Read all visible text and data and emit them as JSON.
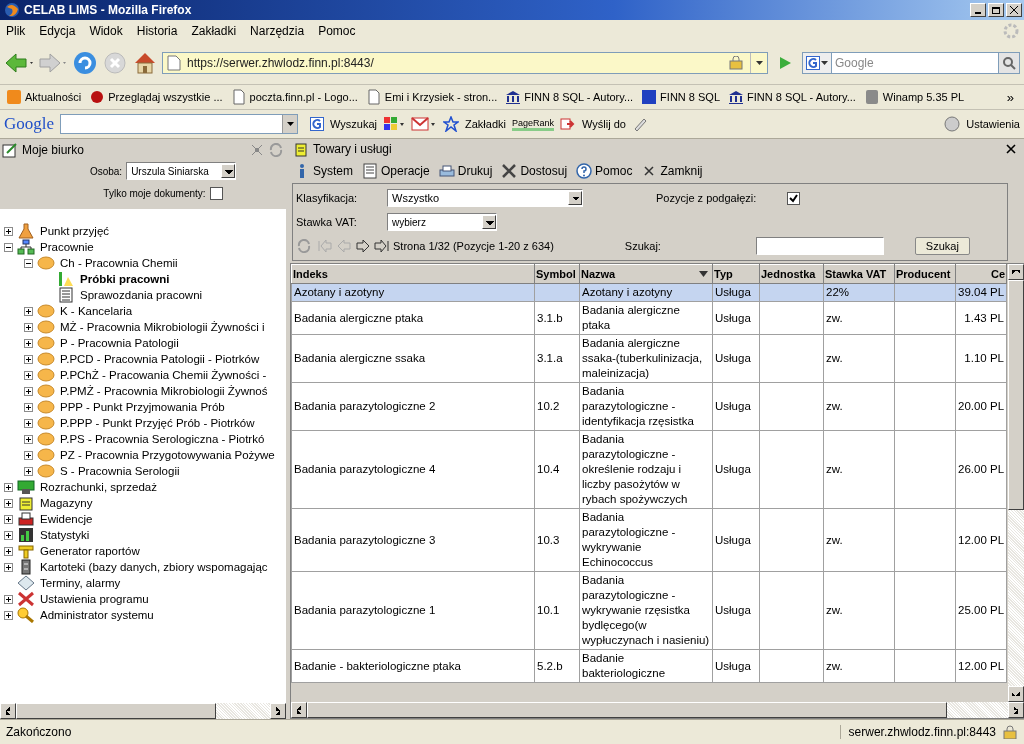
{
  "window": {
    "title": "CELAB LIMS - Mozilla Firefox"
  },
  "menu": [
    "Plik",
    "Edycja",
    "Widok",
    "Historia",
    "Zakładki",
    "Narzędzia",
    "Pomoc"
  ],
  "address": {
    "url": "https://serwer.zhwlodz.finn.pl:8443/"
  },
  "search": {
    "placeholder": "Google"
  },
  "bookmarks": [
    "Aktualności",
    "Przeglądaj wszystkie ...",
    "poczta.finn.pl - Logo...",
    "Emi i Krzysiek - stron...",
    "FINN 8 SQL - Autory...",
    "FINN 8 SQL",
    "FINN 8 SQL - Autory...",
    "Winamp 5.35 PL"
  ],
  "bookmarks_more": "»",
  "google_toolbar": {
    "logo": "Google",
    "search_button": "Wyszukaj",
    "bookmarks": "Zakładki",
    "pagerank": "PageRank",
    "send": "Wyślij do",
    "settings": "Ustawienia"
  },
  "desk": {
    "title": "Moje biurko",
    "person_label": "Osoba:",
    "person": "Urszula Siniarska",
    "only_mine_label": "Tylko moje dokumenty:",
    "only_mine": false,
    "tree": [
      {
        "label": "Punkt przyjęć",
        "expanded": false,
        "selected": false
      },
      {
        "label": "Pracownie",
        "expanded": true,
        "selected": false,
        "children": [
          {
            "label": "Ch - Pracownia Chemii",
            "expanded": true,
            "selected": false,
            "children": [
              {
                "label": "Próbki pracowni",
                "selected": true
              },
              {
                "label": "Sprawozdania pracowni",
                "selected": false
              }
            ]
          },
          {
            "label": "K - Kancelaria",
            "expanded": false,
            "selected": false
          },
          {
            "label": "MŻ - Pracownia Mikrobiologii Żywności i",
            "expanded": false,
            "selected": false
          },
          {
            "label": "P - Pracownia Patologii",
            "expanded": false,
            "selected": false
          },
          {
            "label": "P.PCD - Pracownia Patologii - Piotrków",
            "expanded": false,
            "selected": false
          },
          {
            "label": "P.PChŻ - Pracowania Chemii Żywności -",
            "expanded": false,
            "selected": false
          },
          {
            "label": "P.PMŻ - Pracownia Mikrobiologii Żywnoś",
            "expanded": false,
            "selected": false
          },
          {
            "label": "PPP - Punkt Przyjmowania Prób",
            "expanded": false,
            "selected": false
          },
          {
            "label": "P.PPP - Punkt Przyjęć Prób - Piotrków",
            "expanded": false,
            "selected": false
          },
          {
            "label": "P.PS - Pracownia Serologiczna - Piotrkó",
            "expanded": false,
            "selected": false
          },
          {
            "label": "PZ - Pracownia Przygotowywania Pożywe",
            "expanded": false,
            "selected": false
          },
          {
            "label": "S - Pracownia Serologii",
            "expanded": false,
            "selected": false
          }
        ]
      },
      {
        "label": "Rozrachunki, sprzedaż",
        "expanded": false,
        "selected": false
      },
      {
        "label": "Magazyny",
        "expanded": false,
        "selected": false
      },
      {
        "label": "Ewidencje",
        "expanded": false,
        "selected": false
      },
      {
        "label": "Statystyki",
        "expanded": false,
        "selected": false
      },
      {
        "label": "Generator raportów",
        "expanded": false,
        "selected": false
      },
      {
        "label": "Kartoteki (bazy danych, zbiory wspomagając",
        "expanded": false,
        "selected": false
      },
      {
        "label": "Terminy, alarmy",
        "selected": false
      },
      {
        "label": "Ustawienia programu",
        "expanded": false,
        "selected": false
      },
      {
        "label": "Administrator systemu",
        "expanded": false,
        "selected": false
      }
    ]
  },
  "panel": {
    "title": "Towary i usługi",
    "toolbar": [
      "System",
      "Operacje",
      "Drukuj",
      "Dostosuj",
      "Pomoc",
      "Zamknij"
    ],
    "filters": {
      "classification_label": "Klasyfikacja:",
      "classification": "Wszystko",
      "subbranches_label": "Pozycje z podgałęzi:",
      "subbranches": true,
      "vat_label": "Stawka VAT:",
      "vat": "wybierz",
      "page_info": "Strona 1/32 (Pozycje 1-20 z 634)",
      "search_label": "Szukaj:",
      "search_button": "Szukaj"
    },
    "table": {
      "columns": [
        {
          "label": "Indeks",
          "sorted": false
        },
        {
          "label": "Symbol",
          "sorted": false
        },
        {
          "label": "Nazwa",
          "sorted": true
        },
        {
          "label": "Typ",
          "sorted": false
        },
        {
          "label": "Jednostka",
          "sorted": false
        },
        {
          "label": "Stawka VAT",
          "sorted": false
        },
        {
          "label": "Producent",
          "sorted": false
        },
        {
          "label": "Ce",
          "sorted": false
        }
      ],
      "rows": [
        {
          "selected": true,
          "cells": [
            "Azotany i azotyny",
            "",
            "Azotany i azotyny",
            "Usługa",
            "",
            "22%",
            "",
            "39.04 PL"
          ]
        },
        {
          "selected": false,
          "cells": [
            "Badania alergiczne ptaka",
            "3.1.b",
            "Badania alergiczne ptaka",
            "Usługa",
            "",
            "zw.",
            "",
            "1.43 PL"
          ]
        },
        {
          "selected": false,
          "cells": [
            "Badania alergiczne ssaka",
            "3.1.a",
            "Badania alergiczne ssaka-(tuberkulinizacja, maleinizacja)",
            "Usługa",
            "",
            "zw.",
            "",
            "1.10 PL"
          ]
        },
        {
          "selected": false,
          "cells": [
            "Badania parazytologiczne 2",
            "10.2",
            "Badania parazytologiczne - identyfikacja rzęsistka",
            "Usługa",
            "",
            "zw.",
            "",
            "20.00 PL"
          ]
        },
        {
          "selected": false,
          "cells": [
            "Badania parazytologiczne 4",
            "10.4",
            "Badania parazytologiczne - określenie rodzaju i liczby pasożytów w rybach spożywczych",
            "Usługa",
            "",
            "zw.",
            "",
            "26.00 PL"
          ]
        },
        {
          "selected": false,
          "cells": [
            "Badania parazytologiczne 3",
            "10.3",
            "Badania parazytologiczne - wykrywanie Echinococcus",
            "Usługa",
            "",
            "zw.",
            "",
            "12.00 PL"
          ]
        },
        {
          "selected": false,
          "cells": [
            "Badania parazytologiczne 1",
            "10.1",
            "Badania parazytologiczne - wykrywanie rzęsistka bydlęcego(w wypłuczynach i nasieniu)",
            "Usługa",
            "",
            "zw.",
            "",
            "25.00 PL"
          ]
        },
        {
          "selected": false,
          "cells": [
            "Badanie - bakteriologiczne ptaka",
            "5.2.b",
            "Badanie bakteriologiczne",
            "Usługa",
            "",
            "zw.",
            "",
            "12.00 PL"
          ]
        }
      ]
    }
  },
  "status_bar": {
    "text": "Zakończono",
    "host": "serwer.zhwlodz.finn.pl:8443"
  }
}
